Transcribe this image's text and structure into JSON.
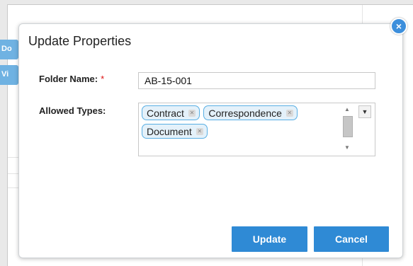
{
  "background": {
    "tab1_label": "Do",
    "tab2_label": "Vi"
  },
  "dialog": {
    "title": "Update Properties",
    "close_icon": "×",
    "folder_name": {
      "label": "Folder Name:",
      "required_marker": "*",
      "value": "AB-15-001"
    },
    "allowed_types": {
      "label": "Allowed Types:",
      "tags": [
        "Contract",
        "Correspondence",
        "Document"
      ],
      "remove_icon": "✕"
    },
    "buttons": {
      "update": "Update",
      "cancel": "Cancel"
    }
  },
  "colors": {
    "accent": "#2f8ad5",
    "tag_border": "#57aee3",
    "tag_fill": "#e4f1fa",
    "required": "#dd1111"
  }
}
